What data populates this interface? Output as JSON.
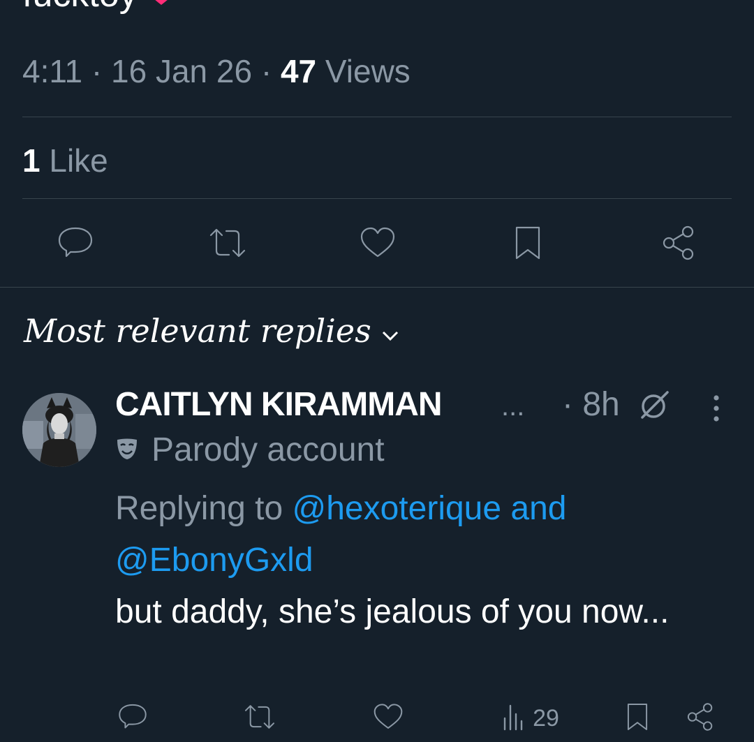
{
  "tweet": {
    "text_tail": "fucktoy",
    "time": "4:11",
    "date": "16 Jan 26",
    "views_count": "47",
    "views_label": "Views",
    "likes_count": "1",
    "likes_label": "Like"
  },
  "replies_section": {
    "sort_label": "Most relevant replies"
  },
  "reply": {
    "display_name": "CAITLYN KIRAMMAN",
    "ellipsis": "...",
    "time": "· 8h",
    "parody_label": "Parody account",
    "replying_prefix": "Replying to",
    "mention_1": "@hexoterique",
    "joiner": "and",
    "mention_2": "@EbonyGxld",
    "body": "but daddy, she’s jealous of you now...",
    "views_count": "29"
  },
  "colors": {
    "background": "#15202b",
    "text": "#ffffff",
    "muted": "#8b98a5",
    "link": "#1d9bf0",
    "divider": "#38444d"
  },
  "icons": {
    "reply": "speech-bubble-icon",
    "retweet": "retweet-icon",
    "like": "heart-icon",
    "bookmark": "bookmark-icon",
    "share": "share-icon",
    "views": "bar-chart-icon",
    "parody": "mask-icon",
    "grok": "grok-icon",
    "more": "more-vertical-icon"
  }
}
